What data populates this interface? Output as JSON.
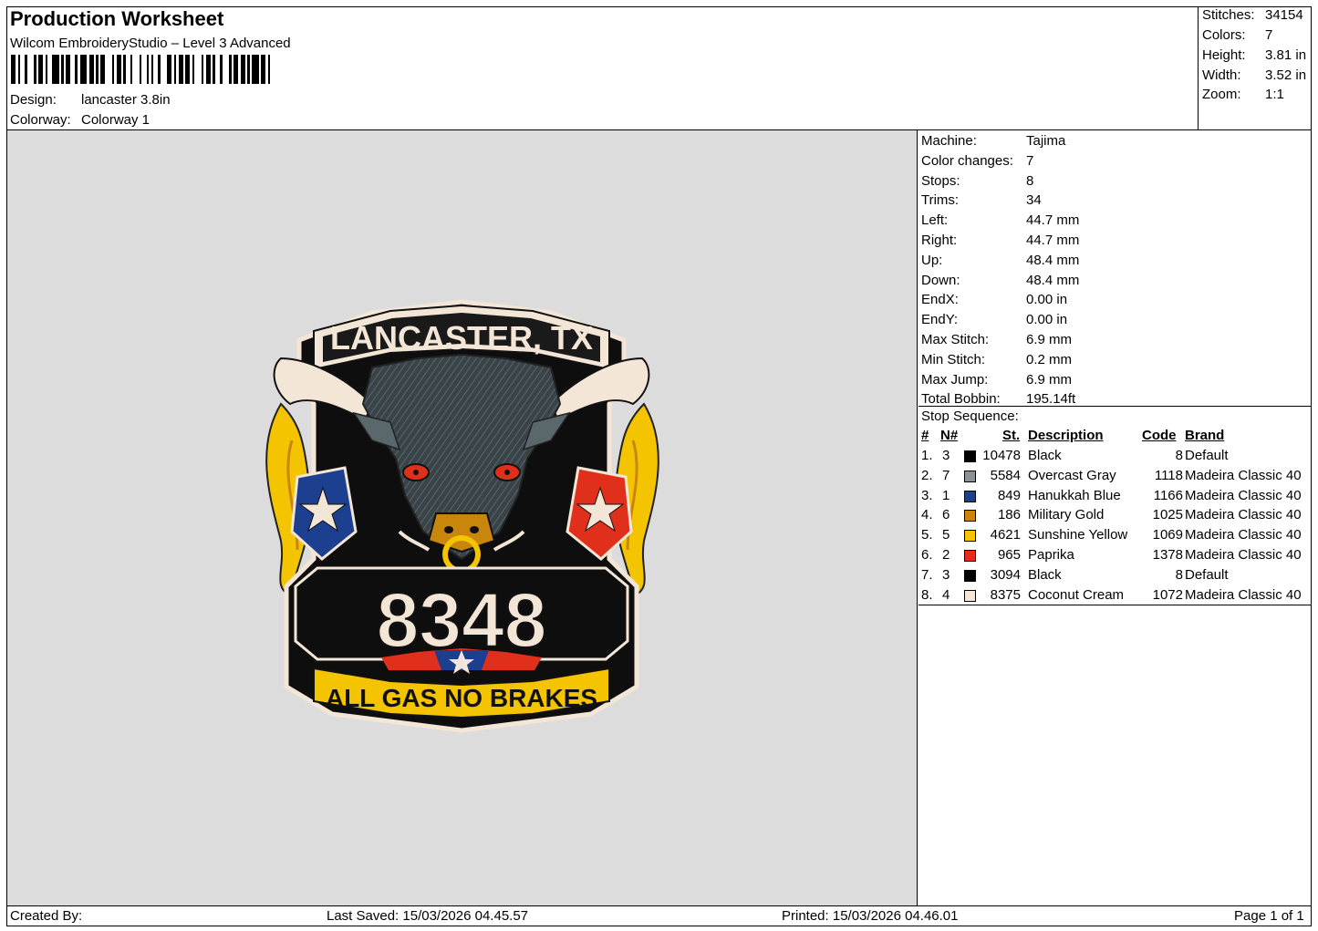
{
  "header": {
    "title": "Production Worksheet",
    "software": "Wilcom EmbroideryStudio – Level 3 Advanced",
    "design_label": "Design:",
    "design_value": "lancaster 3.8in",
    "colorway_label": "Colorway:",
    "colorway_value": "Colorway 1"
  },
  "stats": [
    {
      "label": "Stitches:",
      "value": "34154"
    },
    {
      "label": "Colors:",
      "value": "7"
    },
    {
      "label": "Height:",
      "value": "3.81 in"
    },
    {
      "label": "Width:",
      "value": "3.52 in"
    },
    {
      "label": "Zoom:",
      "value": "1:1"
    }
  ],
  "machine_info": [
    {
      "label": "Machine:",
      "value": "Tajima"
    },
    {
      "label": "Color changes:",
      "value": "7"
    },
    {
      "label": "Stops:",
      "value": "8"
    },
    {
      "label": "Trims:",
      "value": "34"
    },
    {
      "label": "Left:",
      "value": "44.7 mm"
    },
    {
      "label": "Right:",
      "value": "44.7 mm"
    },
    {
      "label": "Up:",
      "value": "48.4 mm"
    },
    {
      "label": "Down:",
      "value": "48.4 mm"
    },
    {
      "label": "EndX:",
      "value": "0.00 in"
    },
    {
      "label": "EndY:",
      "value": "0.00 in"
    },
    {
      "label": "Max Stitch:",
      "value": "6.9 mm"
    },
    {
      "label": "Min Stitch:",
      "value": "0.2 mm"
    },
    {
      "label": "Max Jump:",
      "value": "6.9 mm"
    },
    {
      "label": "Total Bobbin:",
      "value": "195.14ft"
    }
  ],
  "stop_sequence": {
    "title": "Stop Sequence:",
    "headers": {
      "num": "#",
      "needle": "N#",
      "stitches": "St.",
      "description": "Description",
      "code": "Code",
      "brand": "Brand"
    },
    "rows": [
      {
        "num": "1.",
        "needle": "3",
        "color": "#000000",
        "stitches": "10478",
        "description": "Black",
        "code": "8",
        "brand": "Default"
      },
      {
        "num": "2.",
        "needle": "7",
        "color": "#8c9196",
        "stitches": "5584",
        "description": "Overcast Gray",
        "code": "1118",
        "brand": "Madeira Classic 40"
      },
      {
        "num": "3.",
        "needle": "1",
        "color": "#1c3f8f",
        "stitches": "849",
        "description": "Hanukkah Blue",
        "code": "1166",
        "brand": "Madeira Classic 40"
      },
      {
        "num": "4.",
        "needle": "6",
        "color": "#c8860c",
        "stitches": "186",
        "description": "Military Gold",
        "code": "1025",
        "brand": "Madeira Classic 40"
      },
      {
        "num": "5.",
        "needle": "5",
        "color": "#f5c400",
        "stitches": "4621",
        "description": "Sunshine Yellow",
        "code": "1069",
        "brand": "Madeira Classic 40"
      },
      {
        "num": "6.",
        "needle": "2",
        "color": "#e0301c",
        "stitches": "965",
        "description": "Paprika",
        "code": "1378",
        "brand": "Madeira Classic 40"
      },
      {
        "num": "7.",
        "needle": "3",
        "color": "#000000",
        "stitches": "3094",
        "description": "Black",
        "code": "8",
        "brand": "Default"
      },
      {
        "num": "8.",
        "needle": "4",
        "color": "#f3e6d6",
        "stitches": "8375",
        "description": "Coconut Cream",
        "code": "1072",
        "brand": "Madeira Classic 40"
      }
    ]
  },
  "patch": {
    "top_text": "LANCASTER, TX",
    "number_text": "8348",
    "bottom_text": "ALL GAS NO BRAKES"
  },
  "footer": {
    "created_by": "Created By:",
    "last_saved": "Last Saved: 15/03/2026 04.45.57",
    "printed": "Printed: 15/03/2026 04.46.01",
    "page": "Page 1 of 1"
  }
}
